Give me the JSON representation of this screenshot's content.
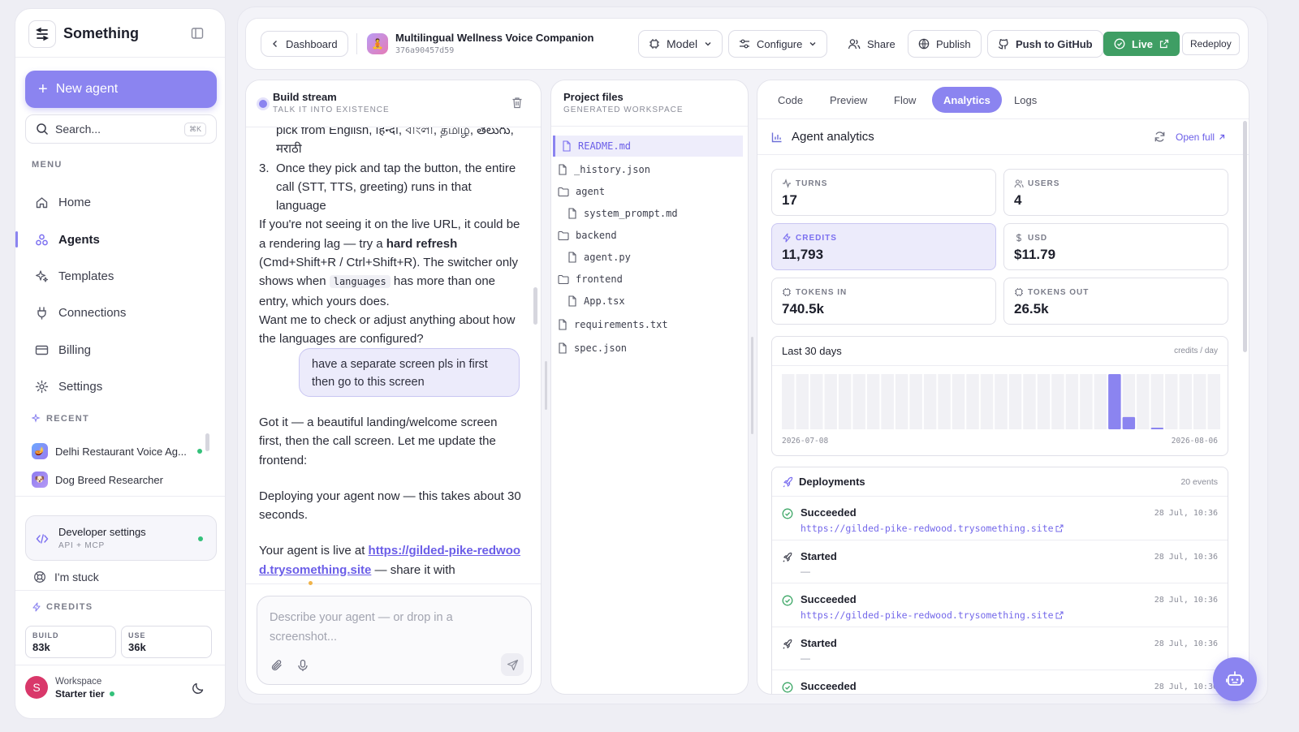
{
  "brand": {
    "name": "Something"
  },
  "sidebar": {
    "new_agent": "New agent",
    "search_placeholder": "Search...",
    "search_kbd": "⌘K",
    "menu_label": "MENU",
    "menu": [
      {
        "label": "Home",
        "icon": "home-icon"
      },
      {
        "label": "Agents",
        "icon": "agents-icon",
        "active": true
      },
      {
        "label": "Templates",
        "icon": "sparkle-icon"
      },
      {
        "label": "Connections",
        "icon": "plug-icon"
      },
      {
        "label": "Billing",
        "icon": "card-icon"
      },
      {
        "label": "Settings",
        "icon": "gear-icon"
      }
    ],
    "recent_label": "RECENT",
    "recent": [
      {
        "label": "Delhi Restaurant Voice Ag...",
        "status": "live"
      },
      {
        "label": "Dog Breed Researcher"
      }
    ],
    "dev": {
      "title": "Developer settings",
      "sub": "API + MCP"
    },
    "stuck": "I'm stuck",
    "credits_label": "CREDITS",
    "credits": [
      {
        "label": "BUILD",
        "value": "83k"
      },
      {
        "label": "USE",
        "value": "36k"
      }
    ],
    "workspace": {
      "avatar": "S",
      "name": "Workspace",
      "tier": "Starter tier"
    }
  },
  "topbar": {
    "back": "Dashboard",
    "agent_name": "Multilingual Wellness Voice Companion",
    "agent_id": "376a90457d59",
    "model": "Model",
    "configure": "Configure",
    "share": "Share",
    "publish": "Publish",
    "github": "Push to GitHub",
    "live": "Live",
    "redeploy": "Redeploy"
  },
  "stream": {
    "title": "Build stream",
    "sub": "TALK IT INTO EXISTENCE",
    "msg1_line_a": "pick from English, हिन्दी, বাংলা, தமிழ, తెలుగు,",
    "msg1_line_b": "मराठी",
    "msg1_item3": "Once they pick and tap the button, the entire call (STT, TTS, greeting) runs in that language",
    "msg1_p1_a": "If you're not seeing it on the live URL, it could be a rendering lag — try a ",
    "msg1_p1_bold": "hard refresh",
    "msg1_p1_b": " (Cmd+Shift+R / Ctrl+Shift+R). The switcher only shows when ",
    "msg1_p1_code": "languages",
    "msg1_p1_c": " has more than one entry, which yours does.",
    "msg1_p2": "Want me to check or adjust anything about how the languages are configured?",
    "user_msg": "have a separate screen pls in first then go to this screen",
    "reply1": "Got it — a beautiful landing/welcome screen first, then the call screen. Let me update the frontend:",
    "reply2": "Deploying your agent now — this takes about 30 seconds.",
    "reply3_a": "Your agent is live at ",
    "reply3_link": "https://gilded-pike-redwood.trysomething.site",
    "reply3_b": " — share it with",
    "composer_placeholder": "Describe your agent — or drop in a screenshot..."
  },
  "files": {
    "title": "Project files",
    "sub": "GENERATED WORKSPACE",
    "items": [
      {
        "name": "README.md",
        "type": "file",
        "depth": 0,
        "selected": true
      },
      {
        "name": "_history.json",
        "type": "file",
        "depth": 0
      },
      {
        "name": "agent",
        "type": "folder",
        "depth": 0
      },
      {
        "name": "system_prompt.md",
        "type": "file",
        "depth": 1
      },
      {
        "name": "backend",
        "type": "folder",
        "depth": 0
      },
      {
        "name": "agent.py",
        "type": "file",
        "depth": 1
      },
      {
        "name": "frontend",
        "type": "folder",
        "depth": 0
      },
      {
        "name": "App.tsx",
        "type": "file",
        "depth": 1
      },
      {
        "name": "requirements.txt",
        "type": "file",
        "depth": 0
      },
      {
        "name": "spec.json",
        "type": "file",
        "depth": 0
      }
    ]
  },
  "analytics": {
    "tabs": [
      "Code",
      "Preview",
      "Flow",
      "Analytics",
      "Logs"
    ],
    "active_tab": "Analytics",
    "title": "Agent analytics",
    "open_full": "Open full",
    "metrics": [
      {
        "label": "TURNS",
        "value": "17",
        "icon": "pulse-icon"
      },
      {
        "label": "USERS",
        "value": "4",
        "icon": "users-icon"
      },
      {
        "label": "CREDITS",
        "value": "11,793",
        "icon": "bolt-icon",
        "highlight": true
      },
      {
        "label": "USD",
        "value": "$11.79",
        "icon": "dollar-icon"
      },
      {
        "label": "TOKENS IN",
        "value": "740.5k",
        "icon": "chip-icon"
      },
      {
        "label": "TOKENS OUT",
        "value": "26.5k",
        "icon": "chip-icon"
      }
    ],
    "chart_title": "Last 30 days",
    "chart_unit": "credits / day",
    "chart_start": "2026-07-08",
    "chart_end": "2026-08-06",
    "deploy_title": "Deployments",
    "deploy_count": "20 events",
    "deployments": [
      {
        "status": "Succeeded",
        "detail": "https://gilded-pike-redwood.trysomething.site",
        "time": "28 Jul, 10:36",
        "icon": "check-circle-icon"
      },
      {
        "status": "Started",
        "detail": "—",
        "time": "28 Jul, 10:36",
        "icon": "rocket-icon"
      },
      {
        "status": "Succeeded",
        "detail": "https://gilded-pike-redwood.trysomething.site",
        "time": "28 Jul, 10:36",
        "icon": "check-circle-icon"
      },
      {
        "status": "Started",
        "detail": "—",
        "time": "28 Jul, 10:36",
        "icon": "rocket-icon"
      },
      {
        "status": "Succeeded",
        "detail": "",
        "time": "28 Jul, 10:36",
        "icon": "check-circle-icon"
      }
    ]
  },
  "chart_data": {
    "type": "bar",
    "x_start": "2026-07-08",
    "x_end": "2026-08-06",
    "values": [
      0,
      0,
      0,
      0,
      0,
      0,
      0,
      0,
      0,
      0,
      0,
      0,
      0,
      0,
      0,
      0,
      0,
      0,
      0,
      0,
      0,
      0,
      0,
      9000,
      2000,
      0,
      100,
      0,
      0,
      0,
      0
    ],
    "ylim": [
      0,
      9000
    ],
    "colors": {
      "bar": "#8b84f0",
      "track": "#f1f1f5"
    }
  }
}
